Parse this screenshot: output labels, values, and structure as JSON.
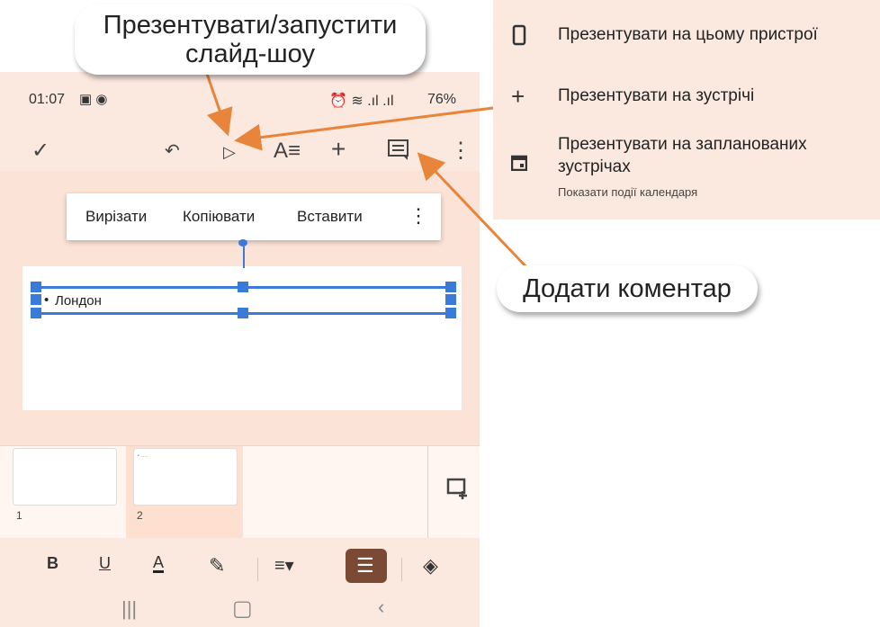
{
  "callouts": {
    "present_line1": "Презентувати/запустити",
    "present_line2": "слайд-шоу",
    "add_comment": "Додати коментар"
  },
  "status_bar": {
    "time": "01:07",
    "battery": "76%"
  },
  "context_menu": {
    "cut": "Вирізати",
    "copy": "Копіювати",
    "paste": "Вставити"
  },
  "slide": {
    "bullet_text": "Лондон"
  },
  "filmstrip": {
    "thumbs": [
      {
        "number": "1"
      },
      {
        "number": "2"
      }
    ]
  },
  "present_menu": {
    "items": [
      {
        "icon": "phone-icon",
        "label": "Презентувати на цьому пристрої"
      },
      {
        "icon": "plus-icon",
        "label": "Презентувати на зустрічі"
      },
      {
        "icon": "calendar-icon",
        "label_line1": "Презентувати на запланованих",
        "label_line2": "зустрічах",
        "sublabel": "Показати події календаря"
      }
    ]
  },
  "format_bar": {
    "bold": "B",
    "underline": "U",
    "text_color": "A"
  },
  "colors": {
    "accent_orange": "#e8853a",
    "selection_blue": "#3a7ad8",
    "active_format": "#7a4a34"
  }
}
